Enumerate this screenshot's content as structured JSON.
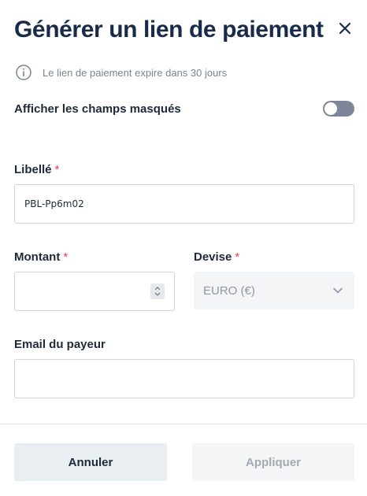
{
  "dialog": {
    "title": "Générer un lien de paiement",
    "close_icon": "close-icon",
    "info_icon": "info-icon",
    "info_text": "Le lien de paiement expire dans 30 jours"
  },
  "toggle": {
    "label": "Afficher les champs masqués",
    "on": false
  },
  "fields": {
    "libelle": {
      "label": "Libellé",
      "required_mark": "*",
      "value": "PBL-Pp6m02"
    },
    "montant": {
      "label": "Montant",
      "required_mark": "*",
      "value": ""
    },
    "devise": {
      "label": "Devise",
      "required_mark": "*",
      "value": "EURO (€)"
    },
    "email": {
      "label": "Email du payeur",
      "value": ""
    }
  },
  "actions": {
    "cancel_label": "Annuler",
    "apply_label": "Appliquer"
  },
  "colors": {
    "title": "#1a2b4a",
    "required": "#e0454a",
    "toggle_off": "#7d8699",
    "cancel_bg": "#e9eef3",
    "disabled_bg": "#f4f5f7"
  }
}
